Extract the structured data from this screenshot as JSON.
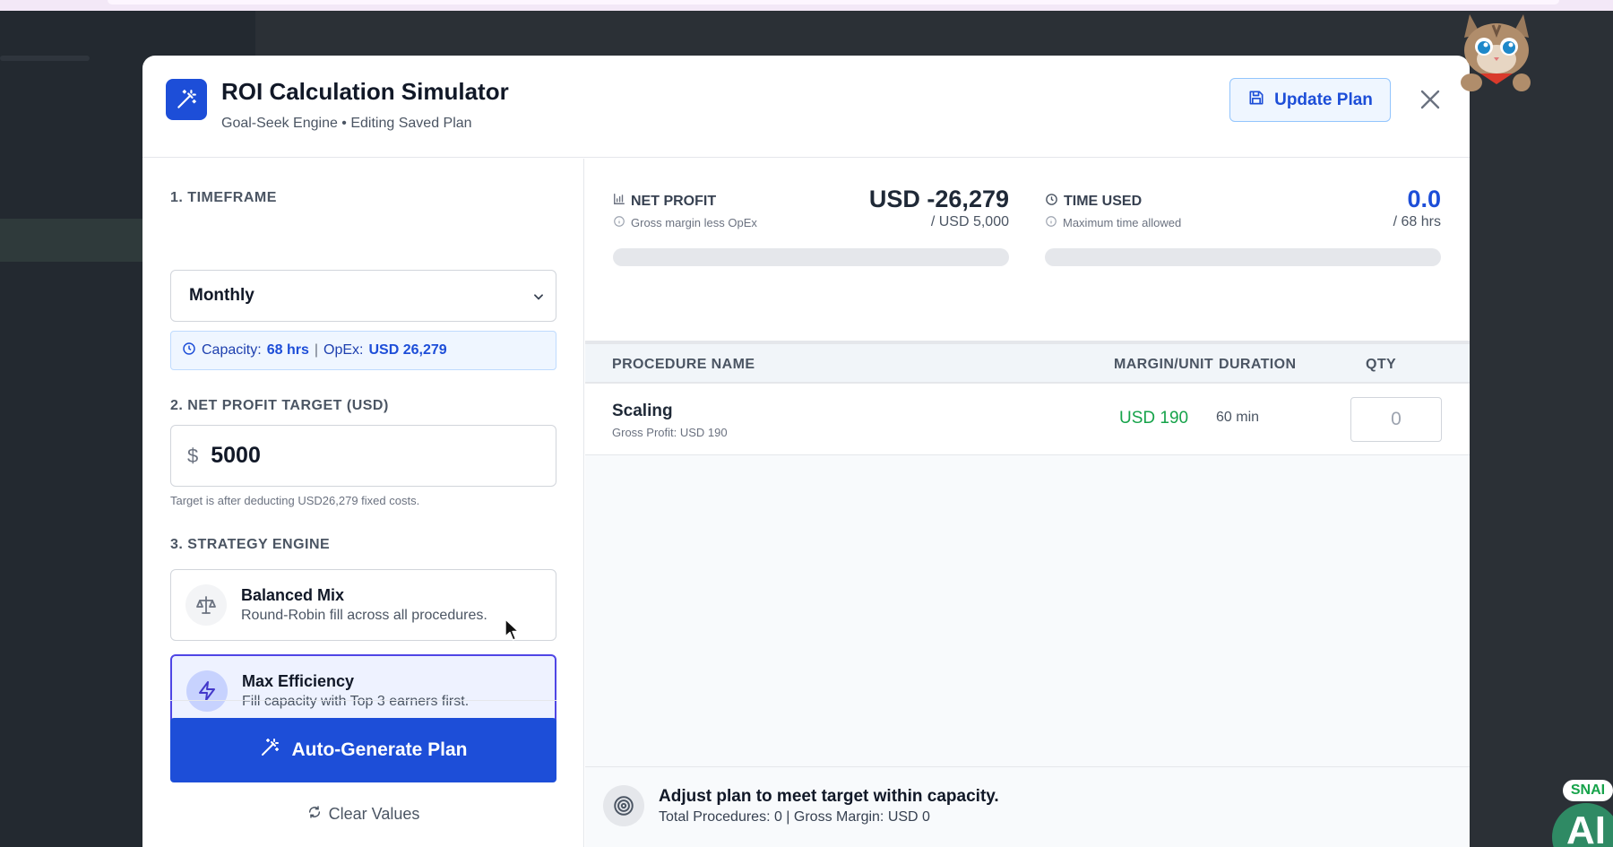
{
  "modal": {
    "title": "ROI Calculation Simulator",
    "subtitle": "Goal-Seek Engine • Editing Saved Plan",
    "update_label": "Update Plan",
    "icons": {
      "header": "magic-wand-icon",
      "update": "save-icon",
      "close": "close-icon"
    }
  },
  "timeframe": {
    "label": "1. TIMEFRAME",
    "selected": "Monthly",
    "capacity_label": "Capacity:",
    "capacity_value": "68 hrs",
    "separator": "|",
    "opex_label": "OpEx:",
    "opex_value": "USD 26,279"
  },
  "target": {
    "label": "2. NET PROFIT TARGET (USD)",
    "currency_symbol": "$",
    "value": "5000",
    "hint": "Target is after deducting USD26,279 fixed costs."
  },
  "strategy": {
    "label": "3. STRATEGY ENGINE",
    "options": [
      {
        "title": "Balanced Mix",
        "desc": "Round-Robin fill across all procedures.",
        "icon": "scale-icon",
        "selected": false
      },
      {
        "title": "Max Efficiency",
        "desc": "Fill capacity with Top 3 earners first.",
        "icon": "lightning-icon",
        "selected": true
      }
    ]
  },
  "actions": {
    "auto_generate": "Auto-Generate Plan",
    "clear": "Clear Values"
  },
  "metrics": {
    "net_profit": {
      "label": "NET PROFIT",
      "note": "Gross margin less OpEx",
      "value": "USD -26,279",
      "target": "/ USD 5,000",
      "progress": 0
    },
    "time_used": {
      "label": "TIME USED",
      "note": "Maximum time allowed",
      "value": "0.0",
      "target": "/ 68 hrs",
      "progress": 0
    }
  },
  "table": {
    "headers": [
      "PROCEDURE NAME",
      "MARGIN/UNIT",
      "DURATION",
      "QTY"
    ],
    "rows": [
      {
        "name": "Scaling",
        "sub": "Gross Profit: USD 190",
        "margin": "USD 190",
        "duration": "60 min",
        "qty": "0"
      }
    ]
  },
  "footer": {
    "title": "Adjust plan to meet target within capacity.",
    "summary": "Total Procedures: 0 | Gross Margin: USD 0"
  },
  "overlay": {
    "badge": "SNAI",
    "logo": "AI"
  },
  "colors": {
    "primary": "#1d4ed8",
    "accent": "#4f46e5",
    "success": "#16a34a"
  }
}
